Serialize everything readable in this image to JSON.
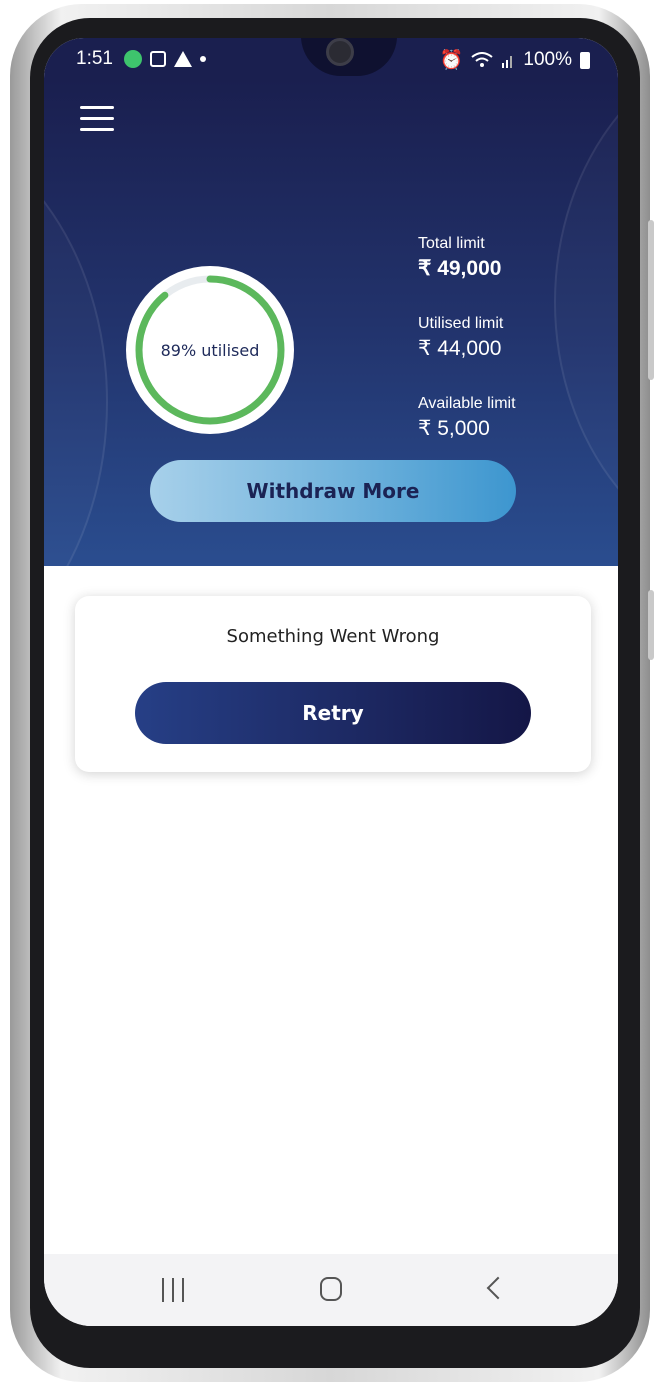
{
  "status_bar": {
    "time": "1:51",
    "battery": "100%",
    "icons": [
      "app-notification-icon",
      "note-icon",
      "warning-icon",
      "dot-icon",
      "alarm-icon",
      "wifi-icon",
      "signal-icon",
      "battery-icon"
    ]
  },
  "header": {
    "menu_icon": "hamburger-menu-icon",
    "utilisation": {
      "label": "89% utilised",
      "percent": 89,
      "ring_color": "#5cb85c"
    },
    "limits": [
      {
        "label": "Total limit",
        "value": "₹ 49,000"
      },
      {
        "label": "Utilised limit",
        "value": "₹ 44,000"
      },
      {
        "label": "Available limit",
        "value": "₹ 5,000"
      }
    ],
    "withdraw_label": "Withdraw More"
  },
  "error_card": {
    "message": "Something Went Wrong",
    "retry_label": "Retry"
  },
  "nav_bar": {
    "icons": [
      "recent-apps-icon",
      "home-icon",
      "back-icon"
    ]
  },
  "colors": {
    "header_top": "#1a1f4f",
    "header_bottom": "#2a4d8f",
    "accent_green": "#5cb85c",
    "withdraw_button": "#6fb2dc",
    "retry_button": "#1c2760"
  }
}
